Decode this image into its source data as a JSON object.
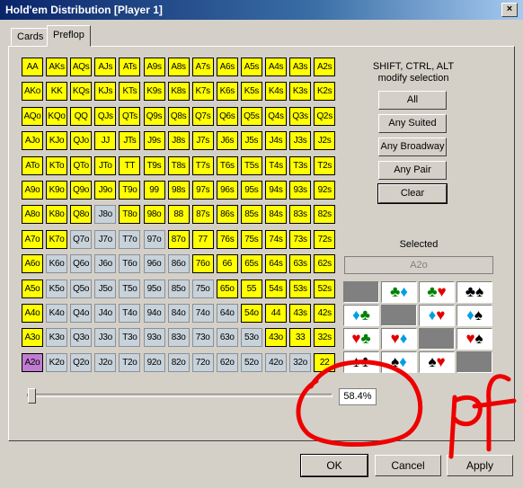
{
  "window": {
    "title": "Hold'em Distribution [Player 1]",
    "close_label": "×"
  },
  "tabs": [
    {
      "label": "Cards"
    },
    {
      "label": "Preflop"
    }
  ],
  "hint": {
    "line1": "SHIFT, CTRL, ALT",
    "line2": "modify selection"
  },
  "buttons": {
    "all": "All",
    "suited": "Any Suited",
    "broadway": "Any Broadway",
    "pair": "Any Pair",
    "clear": "Clear"
  },
  "selected": {
    "label": "Selected",
    "value": "A2o"
  },
  "slider": {
    "percent_text": "58.4%",
    "position": 0.0
  },
  "footer": {
    "ok": "OK",
    "cancel": "Cancel",
    "apply": "Apply"
  },
  "annotation": {
    "text": "pf",
    "color": "#ee0000"
  },
  "colors": {
    "selected_cell": "#ffff00",
    "unselected_cell": "#c8d2da",
    "highlight_cell": "#c07cd0"
  },
  "matrix": [
    [
      [
        "AA",
        "y"
      ],
      [
        "AKs",
        "y"
      ],
      [
        "AQs",
        "y"
      ],
      [
        "AJs",
        "y"
      ],
      [
        "ATs",
        "y"
      ],
      [
        "A9s",
        "y"
      ],
      [
        "A8s",
        "y"
      ],
      [
        "A7s",
        "y"
      ],
      [
        "A6s",
        "y"
      ],
      [
        "A5s",
        "y"
      ],
      [
        "A4s",
        "y"
      ],
      [
        "A3s",
        "y"
      ],
      [
        "A2s",
        "y"
      ]
    ],
    [
      [
        "AKo",
        "y"
      ],
      [
        "KK",
        "y"
      ],
      [
        "KQs",
        "y"
      ],
      [
        "KJs",
        "y"
      ],
      [
        "KTs",
        "y"
      ],
      [
        "K9s",
        "y"
      ],
      [
        "K8s",
        "y"
      ],
      [
        "K7s",
        "y"
      ],
      [
        "K6s",
        "y"
      ],
      [
        "K5s",
        "y"
      ],
      [
        "K4s",
        "y"
      ],
      [
        "K3s",
        "y"
      ],
      [
        "K2s",
        "y"
      ]
    ],
    [
      [
        "AQo",
        "y"
      ],
      [
        "KQo",
        "y"
      ],
      [
        "QQ",
        "y"
      ],
      [
        "QJs",
        "y"
      ],
      [
        "QTs",
        "y"
      ],
      [
        "Q9s",
        "y"
      ],
      [
        "Q8s",
        "y"
      ],
      [
        "Q7s",
        "y"
      ],
      [
        "Q6s",
        "y"
      ],
      [
        "Q5s",
        "y"
      ],
      [
        "Q4s",
        "y"
      ],
      [
        "Q3s",
        "y"
      ],
      [
        "Q2s",
        "y"
      ]
    ],
    [
      [
        "AJo",
        "y"
      ],
      [
        "KJo",
        "y"
      ],
      [
        "QJo",
        "y"
      ],
      [
        "JJ",
        "y"
      ],
      [
        "JTs",
        "y"
      ],
      [
        "J9s",
        "y"
      ],
      [
        "J8s",
        "y"
      ],
      [
        "J7s",
        "y"
      ],
      [
        "J6s",
        "y"
      ],
      [
        "J5s",
        "y"
      ],
      [
        "J4s",
        "y"
      ],
      [
        "J3s",
        "y"
      ],
      [
        "J2s",
        "y"
      ]
    ],
    [
      [
        "ATo",
        "y"
      ],
      [
        "KTo",
        "y"
      ],
      [
        "QTo",
        "y"
      ],
      [
        "JTo",
        "y"
      ],
      [
        "TT",
        "y"
      ],
      [
        "T9s",
        "y"
      ],
      [
        "T8s",
        "y"
      ],
      [
        "T7s",
        "y"
      ],
      [
        "T6s",
        "y"
      ],
      [
        "T5s",
        "y"
      ],
      [
        "T4s",
        "y"
      ],
      [
        "T3s",
        "y"
      ],
      [
        "T2s",
        "y"
      ]
    ],
    [
      [
        "A9o",
        "y"
      ],
      [
        "K9o",
        "y"
      ],
      [
        "Q9o",
        "y"
      ],
      [
        "J9o",
        "y"
      ],
      [
        "T9o",
        "y"
      ],
      [
        "99",
        "y"
      ],
      [
        "98s",
        "y"
      ],
      [
        "97s",
        "y"
      ],
      [
        "96s",
        "y"
      ],
      [
        "95s",
        "y"
      ],
      [
        "94s",
        "y"
      ],
      [
        "93s",
        "y"
      ],
      [
        "92s",
        "y"
      ]
    ],
    [
      [
        "A8o",
        "y"
      ],
      [
        "K8o",
        "y"
      ],
      [
        "Q8o",
        "y"
      ],
      [
        "J8o",
        "n"
      ],
      [
        "T8o",
        "y"
      ],
      [
        "98o",
        "y"
      ],
      [
        "88",
        "y"
      ],
      [
        "87s",
        "y"
      ],
      [
        "86s",
        "y"
      ],
      [
        "85s",
        "y"
      ],
      [
        "84s",
        "y"
      ],
      [
        "83s",
        "y"
      ],
      [
        "82s",
        "y"
      ]
    ],
    [
      [
        "A7o",
        "y"
      ],
      [
        "K7o",
        "y"
      ],
      [
        "Q7o",
        "n"
      ],
      [
        "J7o",
        "n"
      ],
      [
        "T7o",
        "n"
      ],
      [
        "97o",
        "n"
      ],
      [
        "87o",
        "y"
      ],
      [
        "77",
        "y"
      ],
      [
        "76s",
        "y"
      ],
      [
        "75s",
        "y"
      ],
      [
        "74s",
        "y"
      ],
      [
        "73s",
        "y"
      ],
      [
        "72s",
        "y"
      ]
    ],
    [
      [
        "A6o",
        "y"
      ],
      [
        "K6o",
        "n"
      ],
      [
        "Q6o",
        "n"
      ],
      [
        "J6o",
        "n"
      ],
      [
        "T6o",
        "n"
      ],
      [
        "96o",
        "n"
      ],
      [
        "86o",
        "n"
      ],
      [
        "76o",
        "y"
      ],
      [
        "66",
        "y"
      ],
      [
        "65s",
        "y"
      ],
      [
        "64s",
        "y"
      ],
      [
        "63s",
        "y"
      ],
      [
        "62s",
        "y"
      ]
    ],
    [
      [
        "A5o",
        "y"
      ],
      [
        "K5o",
        "n"
      ],
      [
        "Q5o",
        "n"
      ],
      [
        "J5o",
        "n"
      ],
      [
        "T5o",
        "n"
      ],
      [
        "95o",
        "n"
      ],
      [
        "85o",
        "n"
      ],
      [
        "75o",
        "n"
      ],
      [
        "65o",
        "y"
      ],
      [
        "55",
        "y"
      ],
      [
        "54s",
        "y"
      ],
      [
        "53s",
        "y"
      ],
      [
        "52s",
        "y"
      ]
    ],
    [
      [
        "A4o",
        "y"
      ],
      [
        "K4o",
        "n"
      ],
      [
        "Q4o",
        "n"
      ],
      [
        "J4o",
        "n"
      ],
      [
        "T4o",
        "n"
      ],
      [
        "94o",
        "n"
      ],
      [
        "84o",
        "n"
      ],
      [
        "74o",
        "n"
      ],
      [
        "64o",
        "n"
      ],
      [
        "54o",
        "y"
      ],
      [
        "44",
        "y"
      ],
      [
        "43s",
        "y"
      ],
      [
        "42s",
        "y"
      ]
    ],
    [
      [
        "A3o",
        "y"
      ],
      [
        "K3o",
        "n"
      ],
      [
        "Q3o",
        "n"
      ],
      [
        "J3o",
        "n"
      ],
      [
        "T3o",
        "n"
      ],
      [
        "93o",
        "n"
      ],
      [
        "83o",
        "n"
      ],
      [
        "73o",
        "n"
      ],
      [
        "63o",
        "n"
      ],
      [
        "53o",
        "n"
      ],
      [
        "43o",
        "y"
      ],
      [
        "33",
        "y"
      ],
      [
        "32s",
        "y"
      ]
    ],
    [
      [
        "A2o",
        "h"
      ],
      [
        "K2o",
        "n"
      ],
      [
        "Q2o",
        "n"
      ],
      [
        "J2o",
        "n"
      ],
      [
        "T2o",
        "n"
      ],
      [
        "92o",
        "n"
      ],
      [
        "82o",
        "n"
      ],
      [
        "72o",
        "n"
      ],
      [
        "62o",
        "n"
      ],
      [
        "52o",
        "n"
      ],
      [
        "42o",
        "n"
      ],
      [
        "32o",
        "n"
      ],
      [
        "22",
        "y"
      ]
    ]
  ],
  "suit_combos": [
    [
      [],
      [
        "club-g",
        "diamond"
      ],
      [
        "club-g",
        "heart"
      ],
      [
        "club",
        "spade"
      ]
    ],
    [
      [
        "diamond",
        "club-g"
      ],
      [],
      [
        "diamond",
        "heart"
      ],
      [
        "diamond",
        "spade"
      ]
    ],
    [
      [
        "heart",
        "club-g"
      ],
      [
        "heart",
        "diamond"
      ],
      [],
      [
        "heart",
        "spade"
      ]
    ],
    [
      [
        "spade",
        "club"
      ],
      [
        "spade",
        "diamond"
      ],
      [
        "spade",
        "heart"
      ],
      []
    ]
  ]
}
